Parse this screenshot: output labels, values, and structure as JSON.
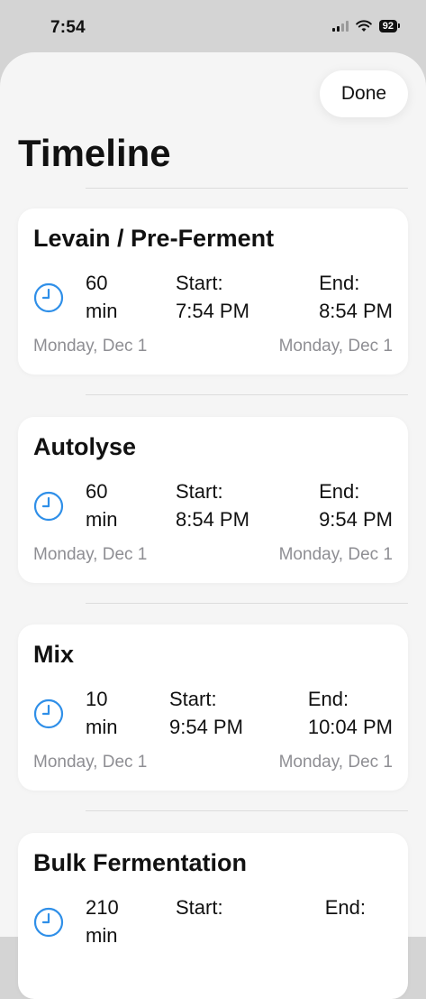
{
  "status": {
    "time": "7:54",
    "battery": "92"
  },
  "header": {
    "done_label": "Done",
    "title": "Timeline"
  },
  "colors": {
    "accent": "#2f8fe8",
    "secondary_text": "#8e8e93"
  },
  "steps": [
    {
      "title": "Levain / Pre-Ferment",
      "duration_value": "60",
      "duration_unit": "min",
      "start_label": "Start:",
      "start_time": "7:54 PM",
      "end_label": "End:",
      "end_time": "8:54 PM",
      "start_date": "Monday, Dec 1",
      "end_date": "Monday, Dec 1",
      "icon": "clock-icon"
    },
    {
      "title": "Autolyse",
      "duration_value": "60",
      "duration_unit": "min",
      "start_label": "Start:",
      "start_time": "8:54 PM",
      "end_label": "End:",
      "end_time": "9:54 PM",
      "start_date": "Monday, Dec 1",
      "end_date": "Monday, Dec 1",
      "icon": "clock-icon"
    },
    {
      "title": "Mix",
      "duration_value": "10",
      "duration_unit": "min",
      "start_label": "Start:",
      "start_time": "9:54 PM",
      "end_label": "End:",
      "end_time": "10:04 PM",
      "start_date": "Monday, Dec 1",
      "end_date": "Monday, Dec 1",
      "icon": "clock-icon"
    },
    {
      "title": "Bulk Fermentation",
      "duration_value": "210",
      "duration_unit": "min",
      "start_label": "Start:",
      "start_time": "",
      "end_label": "End:",
      "end_time": "",
      "start_date": "",
      "end_date": "",
      "icon": "clock-icon"
    }
  ]
}
